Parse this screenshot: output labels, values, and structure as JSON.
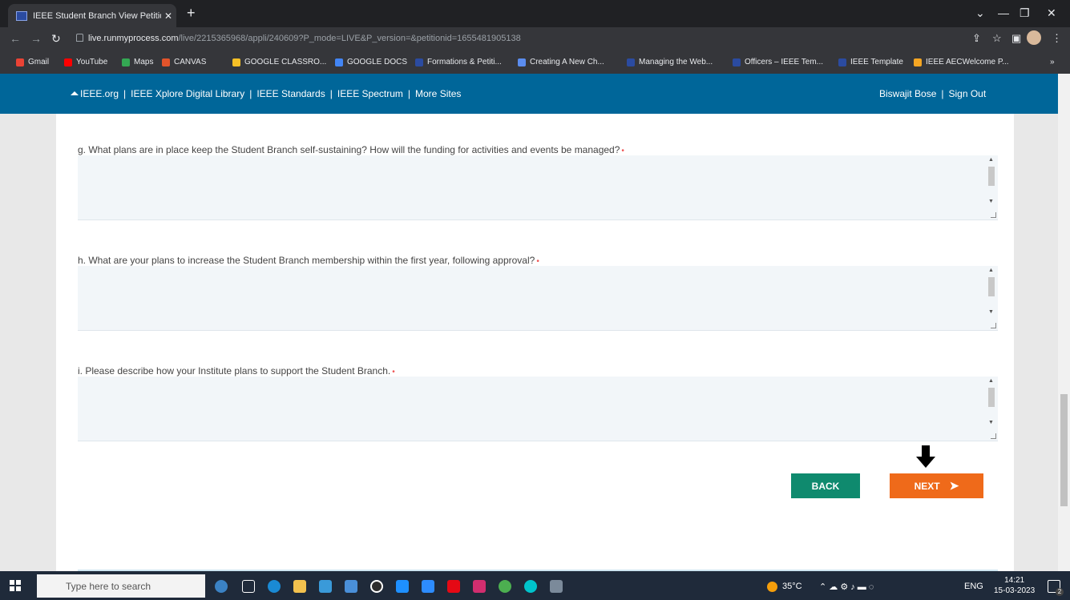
{
  "browser": {
    "tab_title": "IEEE Student Branch View Petitio",
    "tab_close": "✕",
    "new_tab": "+",
    "url_domain": "live.runmyprocess.com",
    "url_path": "/live/2215365968/appli/240609?P_mode=LIVE&P_version=&petitionid=1655481905138",
    "bookmarks": [
      {
        "label": "Gmail",
        "color": "#ea4335"
      },
      {
        "label": "YouTube",
        "color": "#ff0000"
      },
      {
        "label": "Maps",
        "color": "#34a853"
      },
      {
        "label": "CANVAS",
        "color": "#e2542b"
      },
      {
        "label": "GOOGLE CLASSRO...",
        "color": "#f6c026"
      },
      {
        "label": "GOOGLE DOCS",
        "color": "#4285f4"
      },
      {
        "label": "Formations & Petiti...",
        "color": "#2b4ba0"
      },
      {
        "label": "Creating A New Ch...",
        "color": "#5b8def"
      },
      {
        "label": "Managing the Web...",
        "color": "#2b4ba0"
      },
      {
        "label": "Officers – IEEE Tem...",
        "color": "#2b4ba0"
      },
      {
        "label": "IEEE Template",
        "color": "#2b4ba0"
      },
      {
        "label": "IEEE AECWelcome P...",
        "color": "#f5a623"
      }
    ],
    "more_bookmarks": "»"
  },
  "ieee_nav": {
    "links": [
      "IEEE.org",
      "IEEE Xplore Digital Library",
      "IEEE Standards",
      "IEEE Spectrum",
      "More Sites"
    ],
    "separator": "|",
    "user_name": "Biswajit Bose",
    "sign_out": "Sign Out"
  },
  "form": {
    "questions": [
      {
        "label": "g. What plans are in place keep the Student Branch self-sustaining? How will the funding for activities and events be managed?",
        "required": "•",
        "value": ""
      },
      {
        "label": "h. What are your plans to increase the Student Branch membership within the first year, following approval?",
        "required": "•",
        "value": ""
      },
      {
        "label": "i. Please describe how your Institute plans to support the Student Branch.",
        "required": "•",
        "value": ""
      }
    ],
    "back_label": "BACK",
    "next_label": "NEXT",
    "next_arrow": "➤"
  },
  "taskbar": {
    "search_placeholder": "Type here to search",
    "temperature": "35°C",
    "language": "ENG",
    "time": "14:21",
    "date": "15-03-2023",
    "notification_count": "2"
  },
  "colors": {
    "ieee_blue": "#006699",
    "back_button": "#0f8a6e",
    "next_button": "#ef6a1a"
  }
}
